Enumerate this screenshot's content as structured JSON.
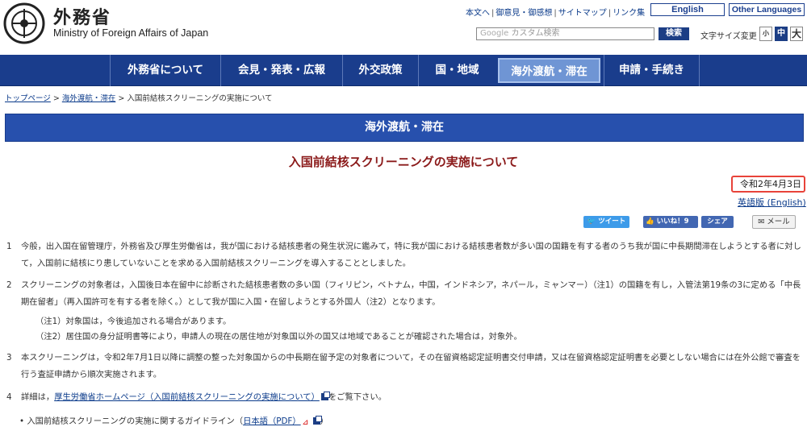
{
  "header": {
    "logo_ja": "外務省",
    "logo_en": "Ministry of Foreign Affairs of Japan",
    "util_links": [
      "本文へ",
      "御意見・御感想",
      "サイトマップ",
      "リンク集"
    ],
    "english_button": "English",
    "other_languages_button": "Other Languages",
    "search_placeholder": "カスタム検索",
    "search_brand": "Google",
    "search_button": "検索",
    "fontsize_label": "文字サイズ変更",
    "fontsize_small": "小",
    "fontsize_mid": "中",
    "fontsize_large": "大"
  },
  "nav": {
    "items": [
      "外務省について",
      "会見・発表・広報",
      "外交政策",
      "国・地域",
      "海外渡航・滞在",
      "申請・手続き"
    ],
    "active": "海外渡航・滞在"
  },
  "breadcrumb": {
    "top": "トップページ",
    "sep": " > ",
    "section": "海外渡航・滞在",
    "current": "入国前結核スクリーニングの実施について"
  },
  "section_banner": "海外渡航・滞在",
  "page_title": "入国前結核スクリーニングの実施について",
  "date": "令和2年4月3日",
  "english_version": "英語版 (English)",
  "social": {
    "tweet": "ツイート",
    "like": "いいね！9",
    "share": "シェア",
    "mail": "メール"
  },
  "paragraphs": [
    {
      "num": "1",
      "text": "今般，出入国在留管理庁，外務省及び厚生労働省は，我が国における結核患者の発生状況に鑑みて，特に我が国における結核患者数が多い国の国籍を有する者のうち我が国に中長期間滞在しようとする者に対して，入国前に結核にり患していないことを求める入国前結核スクリーニングを導入することとしました。"
    },
    {
      "num": "2",
      "text": "スクリーニングの対象者は，入国後日本在留中に診断された結核患者数の多い国（フィリピン，ベトナム，中国，インドネシア，ネパール，ミャンマー）（注1）の国籍を有し，入管法第19条の3に定める「中長期在留者」（再入国許可を有する者を除く。）として我が国に入国・在留しようとする外国人（注2）となります。"
    },
    {
      "num": "3",
      "text": "本スクリーニングは，令和2年7月1日以降に調整の整った対象国からの中長期在留予定の対象者について，その在留資格認定証明書交付申請，又は在留資格認定証明書を必要としない場合には在外公館で審査を行う査証申請から順次実施されます。"
    }
  ],
  "notes": [
    "（注1）対象国は，今後追加される場合があります。",
    "（注2）居住国の身分証明書等により，申請人の現在の居住地が対象国以外の国又は地域であることが確認された場合は，対象外。"
  ],
  "para4": {
    "num": "4",
    "prefix": "詳細は，",
    "link": "厚生労働省ホームページ（入国前結核スクリーニングの実施について）",
    "suffix": "をご覧下さい。"
  },
  "bullet": {
    "text": "入国前結核スクリーニングの実施に関するガイドライン（",
    "link": "日本語（PDF）",
    "suffix": "）"
  }
}
